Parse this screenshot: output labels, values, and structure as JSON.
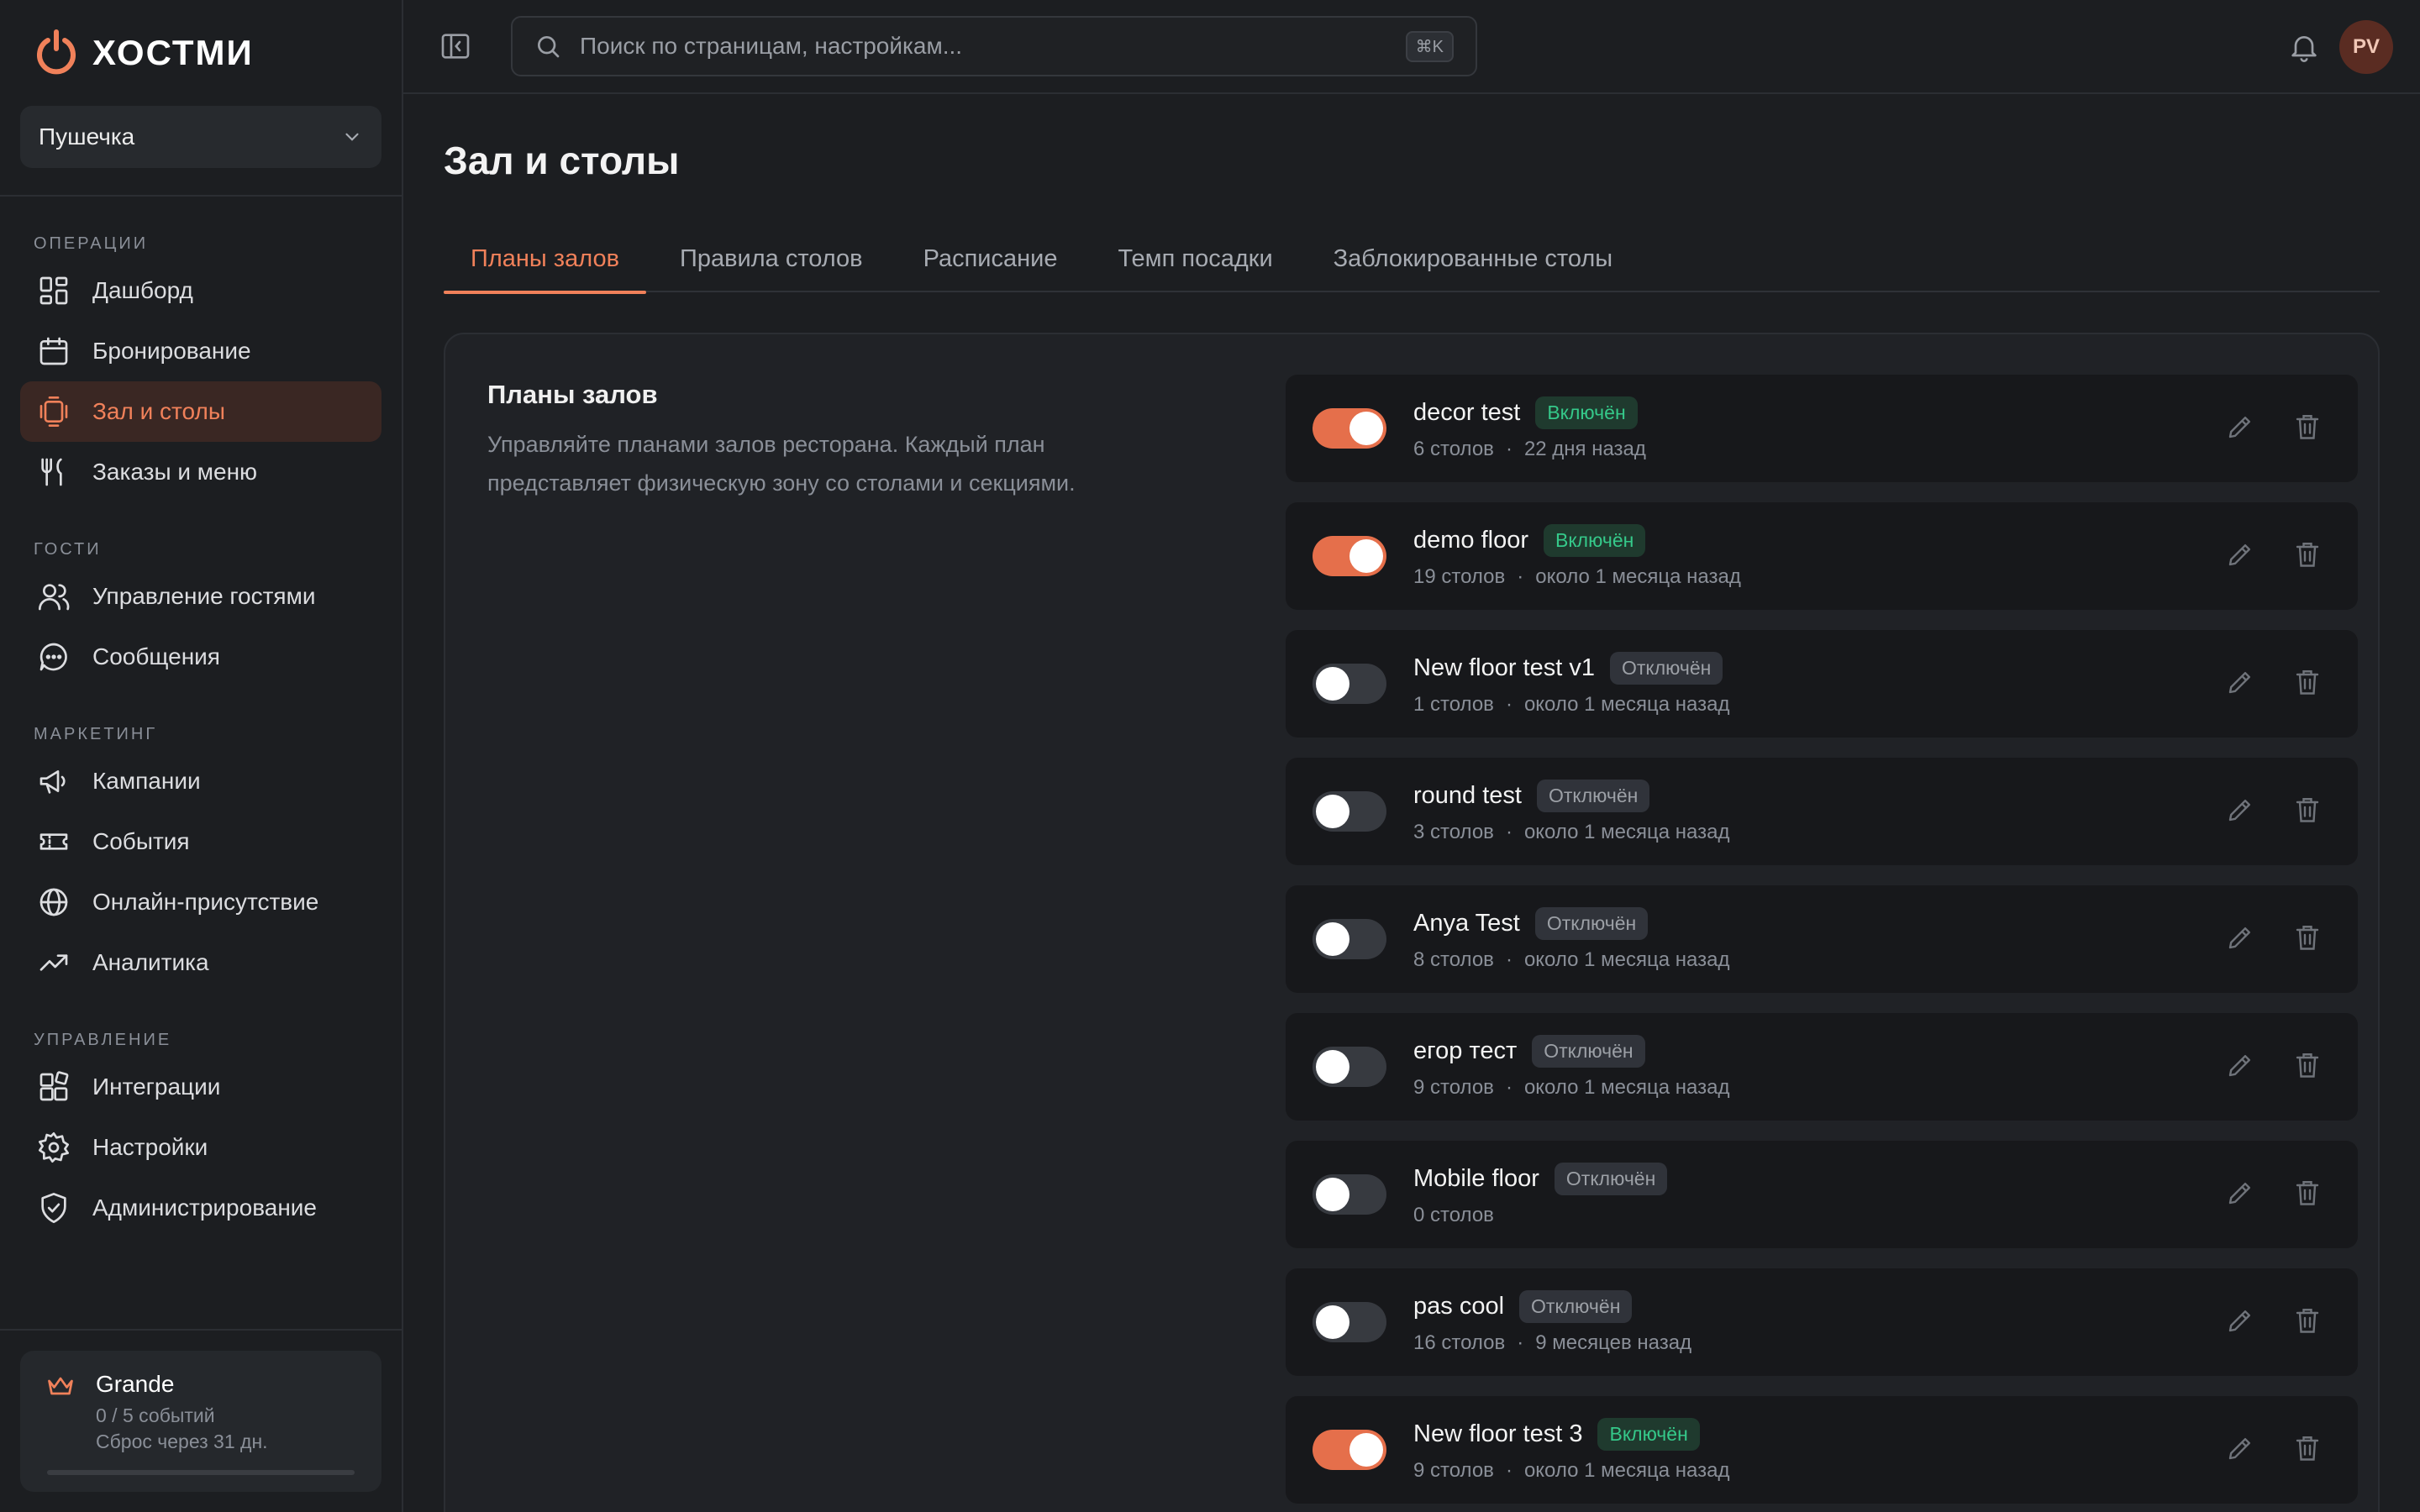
{
  "brand": {
    "name": "ХОСТМИ",
    "accent": "#f0815a"
  },
  "venue": {
    "name": "Пушечка"
  },
  "sidebar": {
    "sections": [
      {
        "title": "ОПЕРАЦИИ",
        "items": [
          {
            "label": "Дашборд",
            "icon": "dashboard-icon"
          },
          {
            "label": "Бронирование",
            "icon": "calendar-icon"
          },
          {
            "label": "Зал и столы",
            "icon": "tables-icon",
            "active": true
          },
          {
            "label": "Заказы и меню",
            "icon": "utensils-icon"
          }
        ]
      },
      {
        "title": "ГОСТИ",
        "items": [
          {
            "label": "Управление гостями",
            "icon": "users-icon"
          },
          {
            "label": "Сообщения",
            "icon": "chat-icon"
          }
        ]
      },
      {
        "title": "МАРКЕТИНГ",
        "items": [
          {
            "label": "Кампании",
            "icon": "megaphone-icon"
          },
          {
            "label": "События",
            "icon": "ticket-icon"
          },
          {
            "label": "Онлайн-присутствие",
            "icon": "globe-icon"
          },
          {
            "label": "Аналитика",
            "icon": "trend-icon"
          }
        ]
      },
      {
        "title": "УПРАВЛЕНИЕ",
        "items": [
          {
            "label": "Интеграции",
            "icon": "integrations-icon"
          },
          {
            "label": "Настройки",
            "icon": "gear-icon"
          },
          {
            "label": "Администрирование",
            "icon": "shield-icon"
          }
        ]
      }
    ],
    "plan": {
      "name": "Grande",
      "usage": "0 / 5 событий",
      "reset": "Сброс через 31 дн.",
      "progress": 0
    }
  },
  "search": {
    "placeholder": "Поиск по страницам, настройкам...",
    "shortcut": "⌘K"
  },
  "user": {
    "initials": "PV"
  },
  "page": {
    "title": "Зал и столы",
    "tabs": [
      "Планы залов",
      "Правила столов",
      "Расписание",
      "Темп посадки",
      "Заблокированные столы"
    ],
    "active_tab": 0
  },
  "panel": {
    "title": "Планы залов",
    "description": "Управляйте планами залов ресторана. Каждый план представляет физическую зону со столами и секциями."
  },
  "floors": [
    {
      "name": "decor test",
      "enabled": true,
      "status": "Включён",
      "tables": "6 столов",
      "updated": "22 дня назад"
    },
    {
      "name": "demo floor",
      "enabled": true,
      "status": "Включён",
      "tables": "19 столов",
      "updated": "около 1 месяца назад"
    },
    {
      "name": "New floor test v1",
      "enabled": false,
      "status": "Отключён",
      "tables": "1 столов",
      "updated": "около 1 месяца назад"
    },
    {
      "name": "round test",
      "enabled": false,
      "status": "Отключён",
      "tables": "3 столов",
      "updated": "около 1 месяца назад"
    },
    {
      "name": "Anya Test",
      "enabled": false,
      "status": "Отключён",
      "tables": "8 столов",
      "updated": "около 1 месяца назад"
    },
    {
      "name": "егор тест",
      "enabled": false,
      "status": "Отключён",
      "tables": "9 столов",
      "updated": "около 1 месяца назад"
    },
    {
      "name": "Mobile floor",
      "enabled": false,
      "status": "Отключён",
      "tables": "0 столов",
      "updated": ""
    },
    {
      "name": "pas cool",
      "enabled": false,
      "status": "Отключён",
      "tables": "16 столов",
      "updated": "9 месяцев назад"
    },
    {
      "name": "New floor test 3",
      "enabled": true,
      "status": "Включён",
      "tables": "9 столов",
      "updated": "около 1 месяца назад"
    }
  ]
}
